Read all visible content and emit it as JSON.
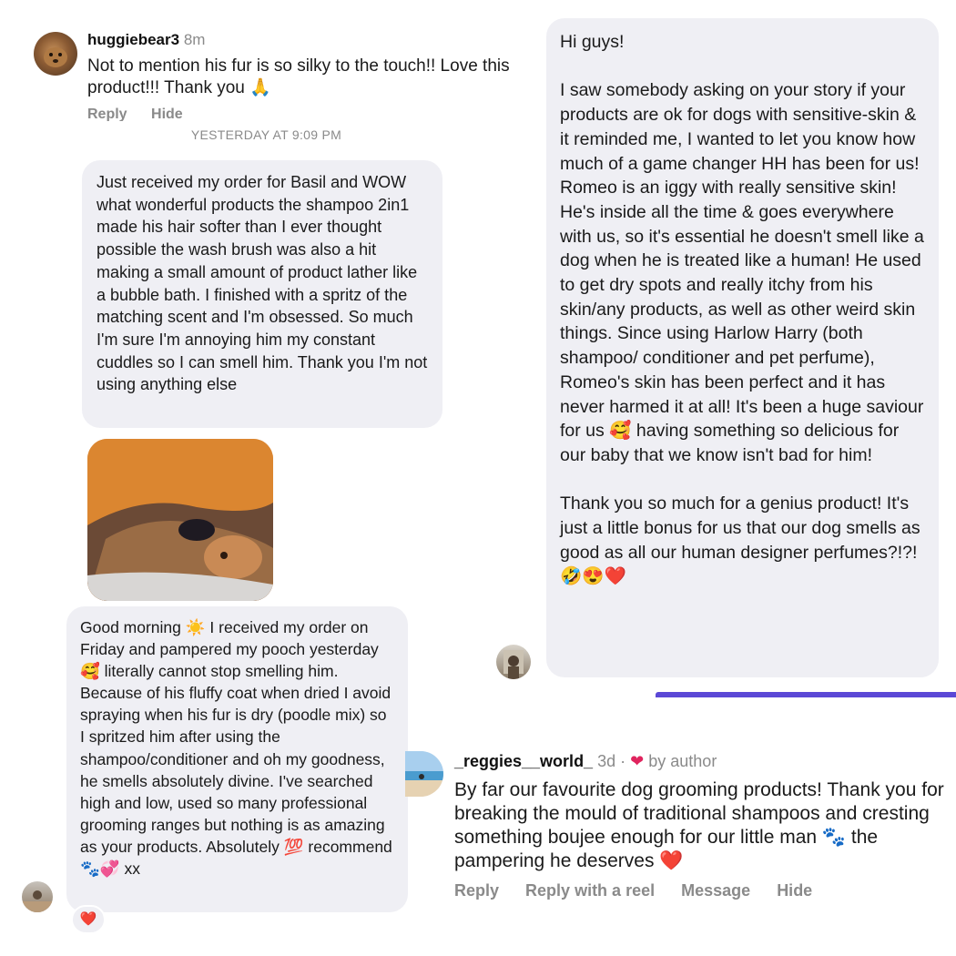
{
  "comment1": {
    "username": "huggiebear3",
    "time": "8m",
    "text": "Not to mention his fur is so silky to the touch!! Love this product!!! Thank you 🙏",
    "reply_label": "Reply",
    "hide_label": "Hide"
  },
  "thread_left": {
    "timestamp": "YESTERDAY AT 9:09 PM",
    "message1": "Just received my order for Basil and WOW what wonderful products the shampoo 2in1 made his hair softer than I ever thought possible the wash brush was also a hit making a small amount of product lather like a bubble bath. I finished with a spritz of the matching scent and I'm obsessed. So much I'm sure I'm annoying him my constant cuddles so I can smell him. Thank you I'm not using anything else",
    "message2": "Good morning ☀️ I received my order on Friday and pampered my pooch yesterday 🥰 literally cannot stop smelling him. Because of his fluffy coat when dried I avoid spraying when his fur is dry (poodle mix) so I spritzed him after using the shampoo/conditioner and oh my goodness, he smells absolutely divine. I've searched high and low, used so many professional grooming ranges but nothing is as amazing as your products. Absolutely 💯 recommend 🐾💞 xx",
    "reaction": "❤️"
  },
  "thread_right": {
    "message": "Hi guys!\n\nI saw somebody asking on your story if your products are ok for dogs with sensitive-skin & it reminded me, I wanted to let you know how much of a game changer HH has been for us! Romeo is an iggy with really sensitive skin! He's inside all the time & goes everywhere with us, so it's essential he doesn't smell like a dog when he is treated like a human! He used to get dry spots and really itchy from his skin/any products, as well as other weird skin things. Since using Harlow Harry (both shampoo/ conditioner and pet perfume), Romeo's skin has been perfect and it has never harmed it at all! It's been a huge saviour for us 🥰 having something so delicious for our baby that we know isn't bad for him!\n\nThank you so much for a genius product! It's just a little bonus for us that our dog smells as good as all our human designer perfumes?!?! 🤣😍❤️"
  },
  "comment2": {
    "username": "_reggies__world_",
    "time": "3d",
    "separator": "·",
    "heart": "❤",
    "by_author": "by author",
    "text": "By far our favourite dog grooming products! Thank you for breaking the mould of traditional shampoos and cresting something boujee enough for our little man 🐾 the pampering he deserves ❤️",
    "actions": [
      "Reply",
      "Reply with a reel",
      "Message",
      "Hide"
    ]
  },
  "colors": {
    "bubble": "#efeff4",
    "accent_bar": "#5b48d6",
    "heart": "#e0245e"
  }
}
